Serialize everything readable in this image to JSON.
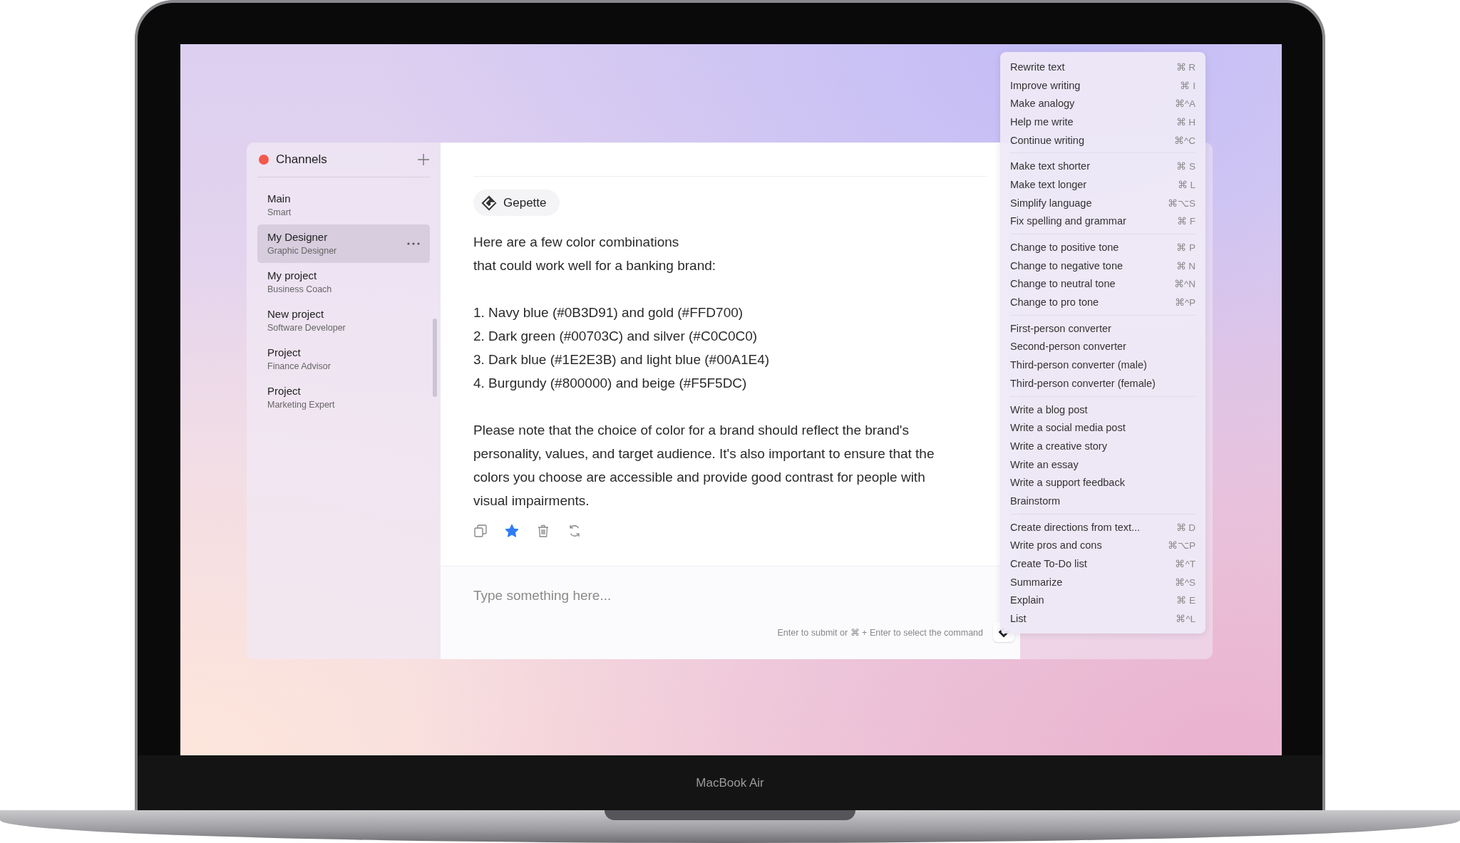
{
  "device_label": "MacBook Air",
  "sidebar": {
    "title": "Channels",
    "items": [
      {
        "name": "Main",
        "role": "Smart",
        "selected": false
      },
      {
        "name": "My Designer",
        "role": "Graphic Designer",
        "selected": true
      },
      {
        "name": "My project",
        "role": "Business Coach",
        "selected": false
      },
      {
        "name": "New project",
        "role": "Software Developer",
        "selected": false
      },
      {
        "name": "Project",
        "role": "Finance Advisor",
        "selected": false
      },
      {
        "name": "Project",
        "role": "Marketing Expert",
        "selected": false
      }
    ]
  },
  "chat": {
    "sender": "Gepette",
    "starred": true,
    "paragraphs": [
      [
        "Here are a few color combinations",
        "that could work well for a banking brand:"
      ],
      [
        "1. Navy blue (#0B3D91) and gold (#FFD700)",
        "2. Dark green (#00703C) and silver (#C0C0C0)",
        "3. Dark blue (#1E2E3B) and light blue (#00A1E4)",
        "4. Burgundy (#800000) and beige (#F5F5DC)"
      ],
      [
        "Please note that the choice of color for a brand should reflect the brand's personality, values, and target audience. It's also important to ensure that the colors you choose are accessible and provide good contrast for people with visual impairments."
      ]
    ],
    "actions": [
      {
        "kind": "copy"
      },
      {
        "kind": "star"
      },
      {
        "kind": "delete"
      },
      {
        "kind": "regenerate"
      }
    ]
  },
  "composer": {
    "placeholder": "Type something here...",
    "hint": "Enter to submit or ⌘ + Enter to select the command"
  },
  "command_menu": {
    "groups": [
      [
        {
          "label": "Rewrite text",
          "shortcut": "⌘ R"
        },
        {
          "label": "Improve writing",
          "shortcut": "⌘ I"
        },
        {
          "label": "Make analogy",
          "shortcut": "⌘^A"
        },
        {
          "label": "Help me write",
          "shortcut": "⌘ H"
        },
        {
          "label": "Continue writing",
          "shortcut": "⌘^C"
        }
      ],
      [
        {
          "label": "Make text shorter",
          "shortcut": "⌘ S"
        },
        {
          "label": "Make text longer",
          "shortcut": "⌘ L"
        },
        {
          "label": "Simplify language",
          "shortcut": "⌘⌥S"
        },
        {
          "label": "Fix spelling and grammar",
          "shortcut": "⌘ F"
        }
      ],
      [
        {
          "label": "Change to positive tone",
          "shortcut": "⌘ P"
        },
        {
          "label": "Change to negative tone",
          "shortcut": "⌘ N"
        },
        {
          "label": "Change to neutral tone",
          "shortcut": "⌘^N"
        },
        {
          "label": "Change to pro tone",
          "shortcut": "⌘^P"
        }
      ],
      [
        {
          "label": "First-person converter"
        },
        {
          "label": "Second-person converter"
        },
        {
          "label": "Third-person converter (male)"
        },
        {
          "label": "Third-person converter (female)"
        }
      ],
      [
        {
          "label": "Write a blog post"
        },
        {
          "label": "Write a social media post"
        },
        {
          "label": "Write a creative story"
        },
        {
          "label": "Write an essay"
        },
        {
          "label": "Write a support feedback"
        },
        {
          "label": "Brainstorm"
        }
      ],
      [
        {
          "label": "Create directions from text...",
          "shortcut": "⌘ D"
        },
        {
          "label": "Write pros and cons",
          "shortcut": "⌘⌥P"
        },
        {
          "label": "Create To-Do list",
          "shortcut": "⌘^T"
        },
        {
          "label": "Summarize",
          "shortcut": "⌘^S"
        },
        {
          "label": "Explain",
          "shortcut": "⌘ E"
        },
        {
          "label": "List",
          "shortcut": "⌘^L"
        }
      ]
    ]
  }
}
